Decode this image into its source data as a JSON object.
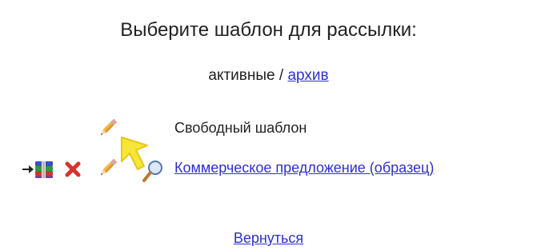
{
  "header": {
    "title": "Выберите шаблон для рассылки:"
  },
  "filters": {
    "active_label": "активные",
    "separator": " / ",
    "archive_label": "архив"
  },
  "templates": [
    {
      "name": "Свободный шаблон",
      "is_link": false,
      "actions": [
        "pencil-icon"
      ]
    },
    {
      "name": "Коммерческое предложение (образец)",
      "is_link": true,
      "actions": [
        "archive-books-icon",
        "delete-x-icon",
        "pencil-icon",
        "view-magnifier-icon"
      ]
    }
  ],
  "footer": {
    "back_label": "Вернуться"
  },
  "colors": {
    "link": "#2f2fcf",
    "delete": "#d8322b",
    "cursor": "#f6e63a"
  }
}
